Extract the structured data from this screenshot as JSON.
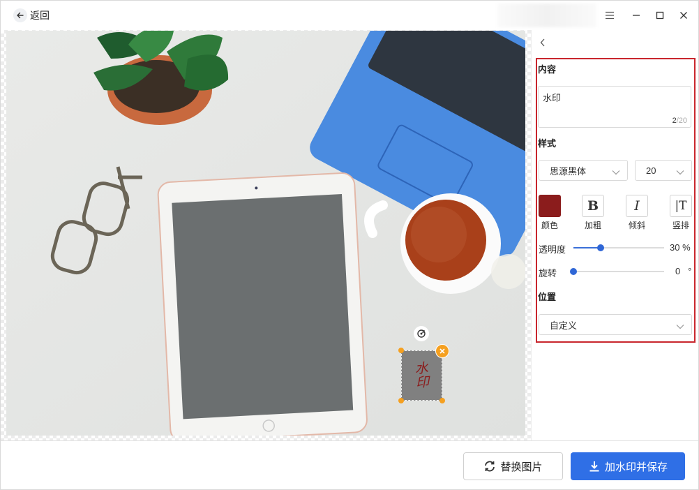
{
  "titlebar": {
    "back_label": "返回",
    "icons": [
      "arrow-left-icon",
      "menu-icon",
      "minimize-icon",
      "maximize-icon",
      "close-icon"
    ]
  },
  "canvas": {
    "watermark_preview_text": "水印",
    "photo_description_icon": "desk-photo"
  },
  "panel": {
    "content": {
      "title": "内容",
      "value": "水印",
      "count": "2",
      "max": "/20"
    },
    "style": {
      "title": "样式",
      "font": "思源黑体",
      "size": "20",
      "color_hex": "#8b1c1c",
      "buttons": [
        {
          "label": "颜色",
          "icon": "color-swatch-icon"
        },
        {
          "label": "加粗",
          "icon": "bold-icon"
        },
        {
          "label": "倾斜",
          "icon": "italic-icon"
        },
        {
          "label": "竖排",
          "icon": "vertical-text-icon"
        }
      ]
    },
    "opacity": {
      "label": "透明度",
      "value": 30,
      "unit": "%"
    },
    "rotation": {
      "label": "旋转",
      "value": 0,
      "unit": "°"
    },
    "position": {
      "title": "位置",
      "value": "自定义"
    }
  },
  "footer": {
    "replace_label": "替换图片",
    "save_label": "加水印并保存"
  },
  "colors": {
    "accent": "#2f6fe6",
    "highlight_border": "#c9262d",
    "handle": "#f5a020"
  }
}
